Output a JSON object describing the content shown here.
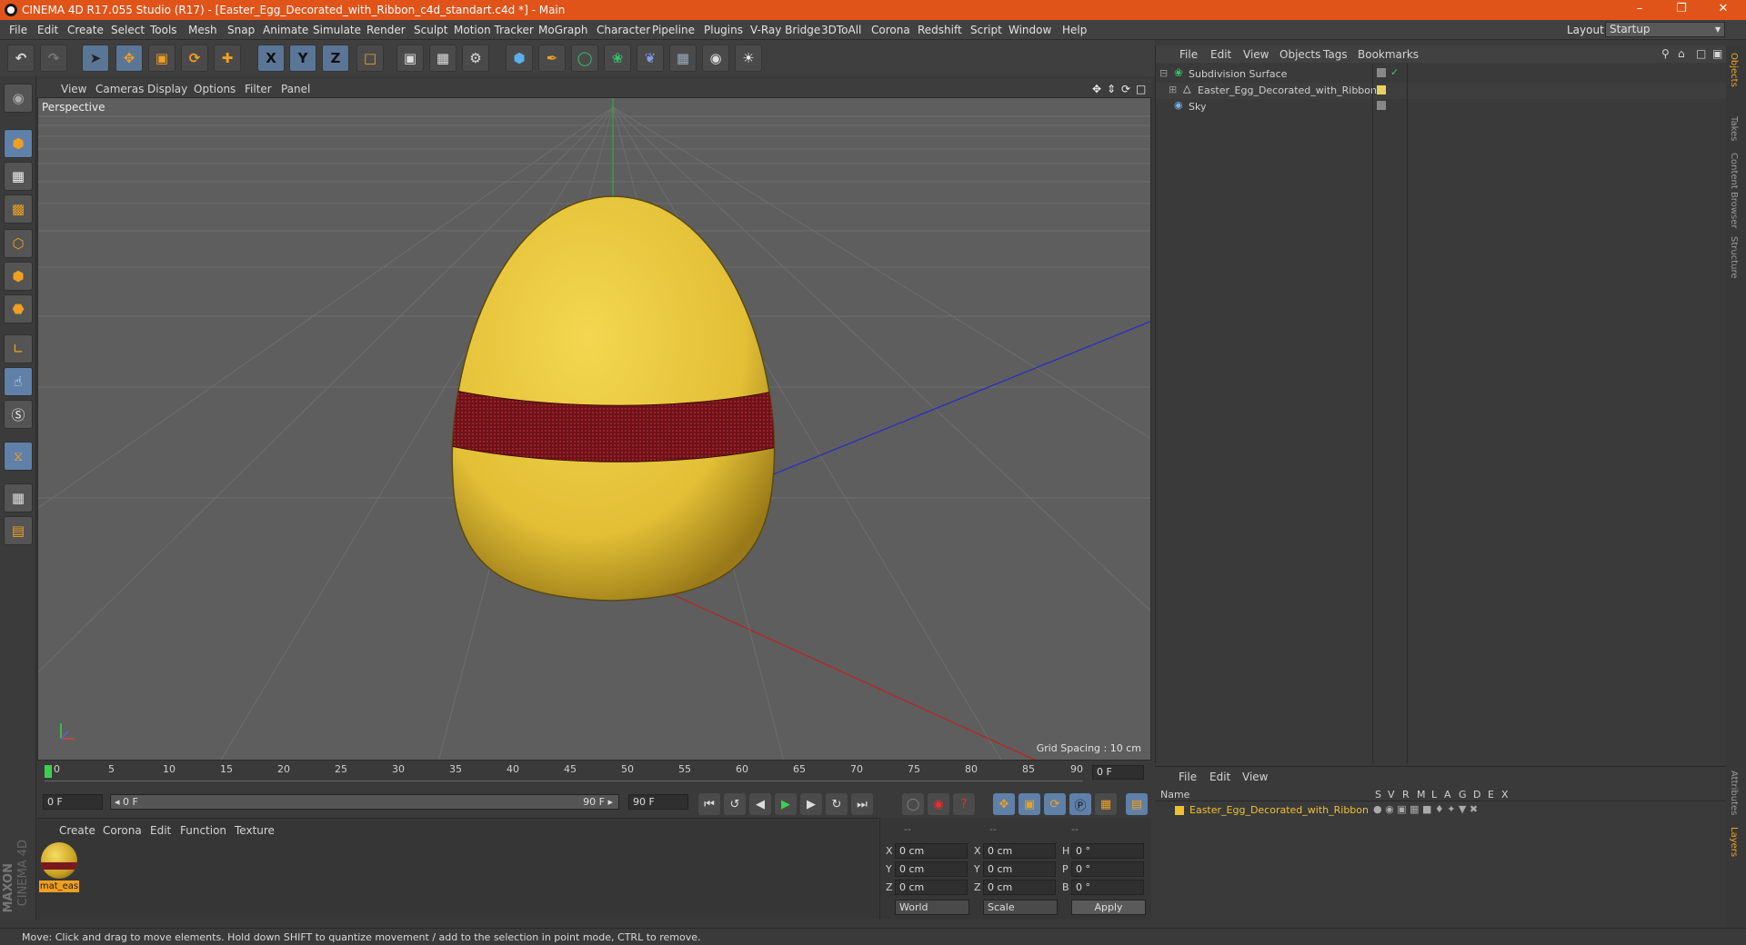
{
  "window": {
    "title": "CINEMA 4D R17.055 Studio (R17) - [Easter_Egg_Decorated_with_Ribbon_c4d_standart.c4d *] - Main",
    "minimize": "–",
    "restore": "❒",
    "close": "✕"
  },
  "menu": {
    "items": [
      "File",
      "Edit",
      "Create",
      "Select",
      "Tools",
      "Mesh",
      "Snap",
      "Animate",
      "Simulate",
      "Render",
      "Sculpt",
      "Motion Tracker",
      "MoGraph",
      "Character",
      "Pipeline",
      "Plugins",
      "V-Ray Bridge",
      "3DToAll",
      "Corona",
      "Redshift",
      "Script",
      "Window",
      "Help"
    ],
    "layout_label": "Layout:",
    "layout_value": "Startup"
  },
  "toolbar": {
    "icons": [
      "undo-icon",
      "redo-icon",
      "select-icon",
      "move-icon",
      "scale-icon",
      "rotate-icon",
      "live-select-icon",
      "x-axis-icon",
      "y-axis-icon",
      "z-axis-icon",
      "coordinate-system-icon",
      "render-view-icon",
      "render-picture-viewer-icon",
      "render-settings-icon",
      "cube-icon",
      "pen-icon",
      "subdivision-icon",
      "cloner-icon",
      "deformer-icon",
      "floor-icon",
      "camera-icon",
      "light-icon"
    ],
    "axis_x": "X",
    "axis_y": "Y",
    "axis_z": "Z"
  },
  "viewport": {
    "menu": [
      "View",
      "Cameras",
      "Display",
      "Options",
      "Filter",
      "Panel"
    ],
    "label": "Perspective",
    "grid_spacing": "Grid Spacing : 10 cm",
    "egg_color": "#e8c63c",
    "ribbon_color": "#8a1a20"
  },
  "timeline": {
    "ticks": [
      "0",
      "5",
      "10",
      "15",
      "20",
      "25",
      "30",
      "35",
      "40",
      "45",
      "50",
      "55",
      "60",
      "65",
      "70",
      "75",
      "80",
      "85",
      "90"
    ],
    "current_frame": "0 F"
  },
  "transport": {
    "start_field": "0 F",
    "range_start": "◂ 0 F",
    "range_end": "90 F ▸",
    "end_field": "90 F"
  },
  "materials": {
    "menu": [
      "Create",
      "Corona",
      "Edit",
      "Function",
      "Texture"
    ],
    "items": [
      {
        "name": "mat_eas"
      }
    ]
  },
  "coords": {
    "headers": [
      "--",
      "--",
      "--"
    ],
    "rows": [
      {
        "a": "X",
        "v1": "0 cm",
        "b": "X",
        "v2": "0 cm",
        "c": "H",
        "v3": "0 °"
      },
      {
        "a": "Y",
        "v1": "0 cm",
        "b": "Y",
        "v2": "0 cm",
        "c": "P",
        "v3": "0 °"
      },
      {
        "a": "Z",
        "v1": "0 cm",
        "b": "Z",
        "v2": "0 cm",
        "c": "B",
        "v3": "0 °"
      }
    ],
    "mode1": "World",
    "mode2": "Scale",
    "apply": "Apply"
  },
  "objects": {
    "menu": [
      "File",
      "Edit",
      "View",
      "Objects",
      "Tags",
      "Bookmarks"
    ],
    "items": [
      {
        "name": "Subdivision Surface",
        "icon": "subdivision-icon"
      },
      {
        "name": "Easter_Egg_Decorated_with_Ribbon",
        "icon": "polygon-object-icon"
      },
      {
        "name": "Sky",
        "icon": "sky-icon"
      }
    ]
  },
  "layers": {
    "menu": [
      "File",
      "Edit",
      "View"
    ],
    "col_name": "Name",
    "cols": [
      "S",
      "V",
      "R",
      "M",
      "L",
      "A",
      "G",
      "D",
      "E",
      "X"
    ],
    "items": [
      {
        "name": "Easter_Egg_Decorated_with_Ribbon",
        "color": "#f0c030"
      }
    ]
  },
  "right_tabs": [
    "Objects",
    "Takes",
    "Content Browser",
    "Structure",
    "Attributes",
    "Layers"
  ],
  "brand": {
    "line1": "MAXON",
    "line2": "CINEMA 4D"
  },
  "status": "Move: Click and drag to move elements. Hold down SHIFT to quantize movement / add to the selection in point mode, CTRL to remove."
}
